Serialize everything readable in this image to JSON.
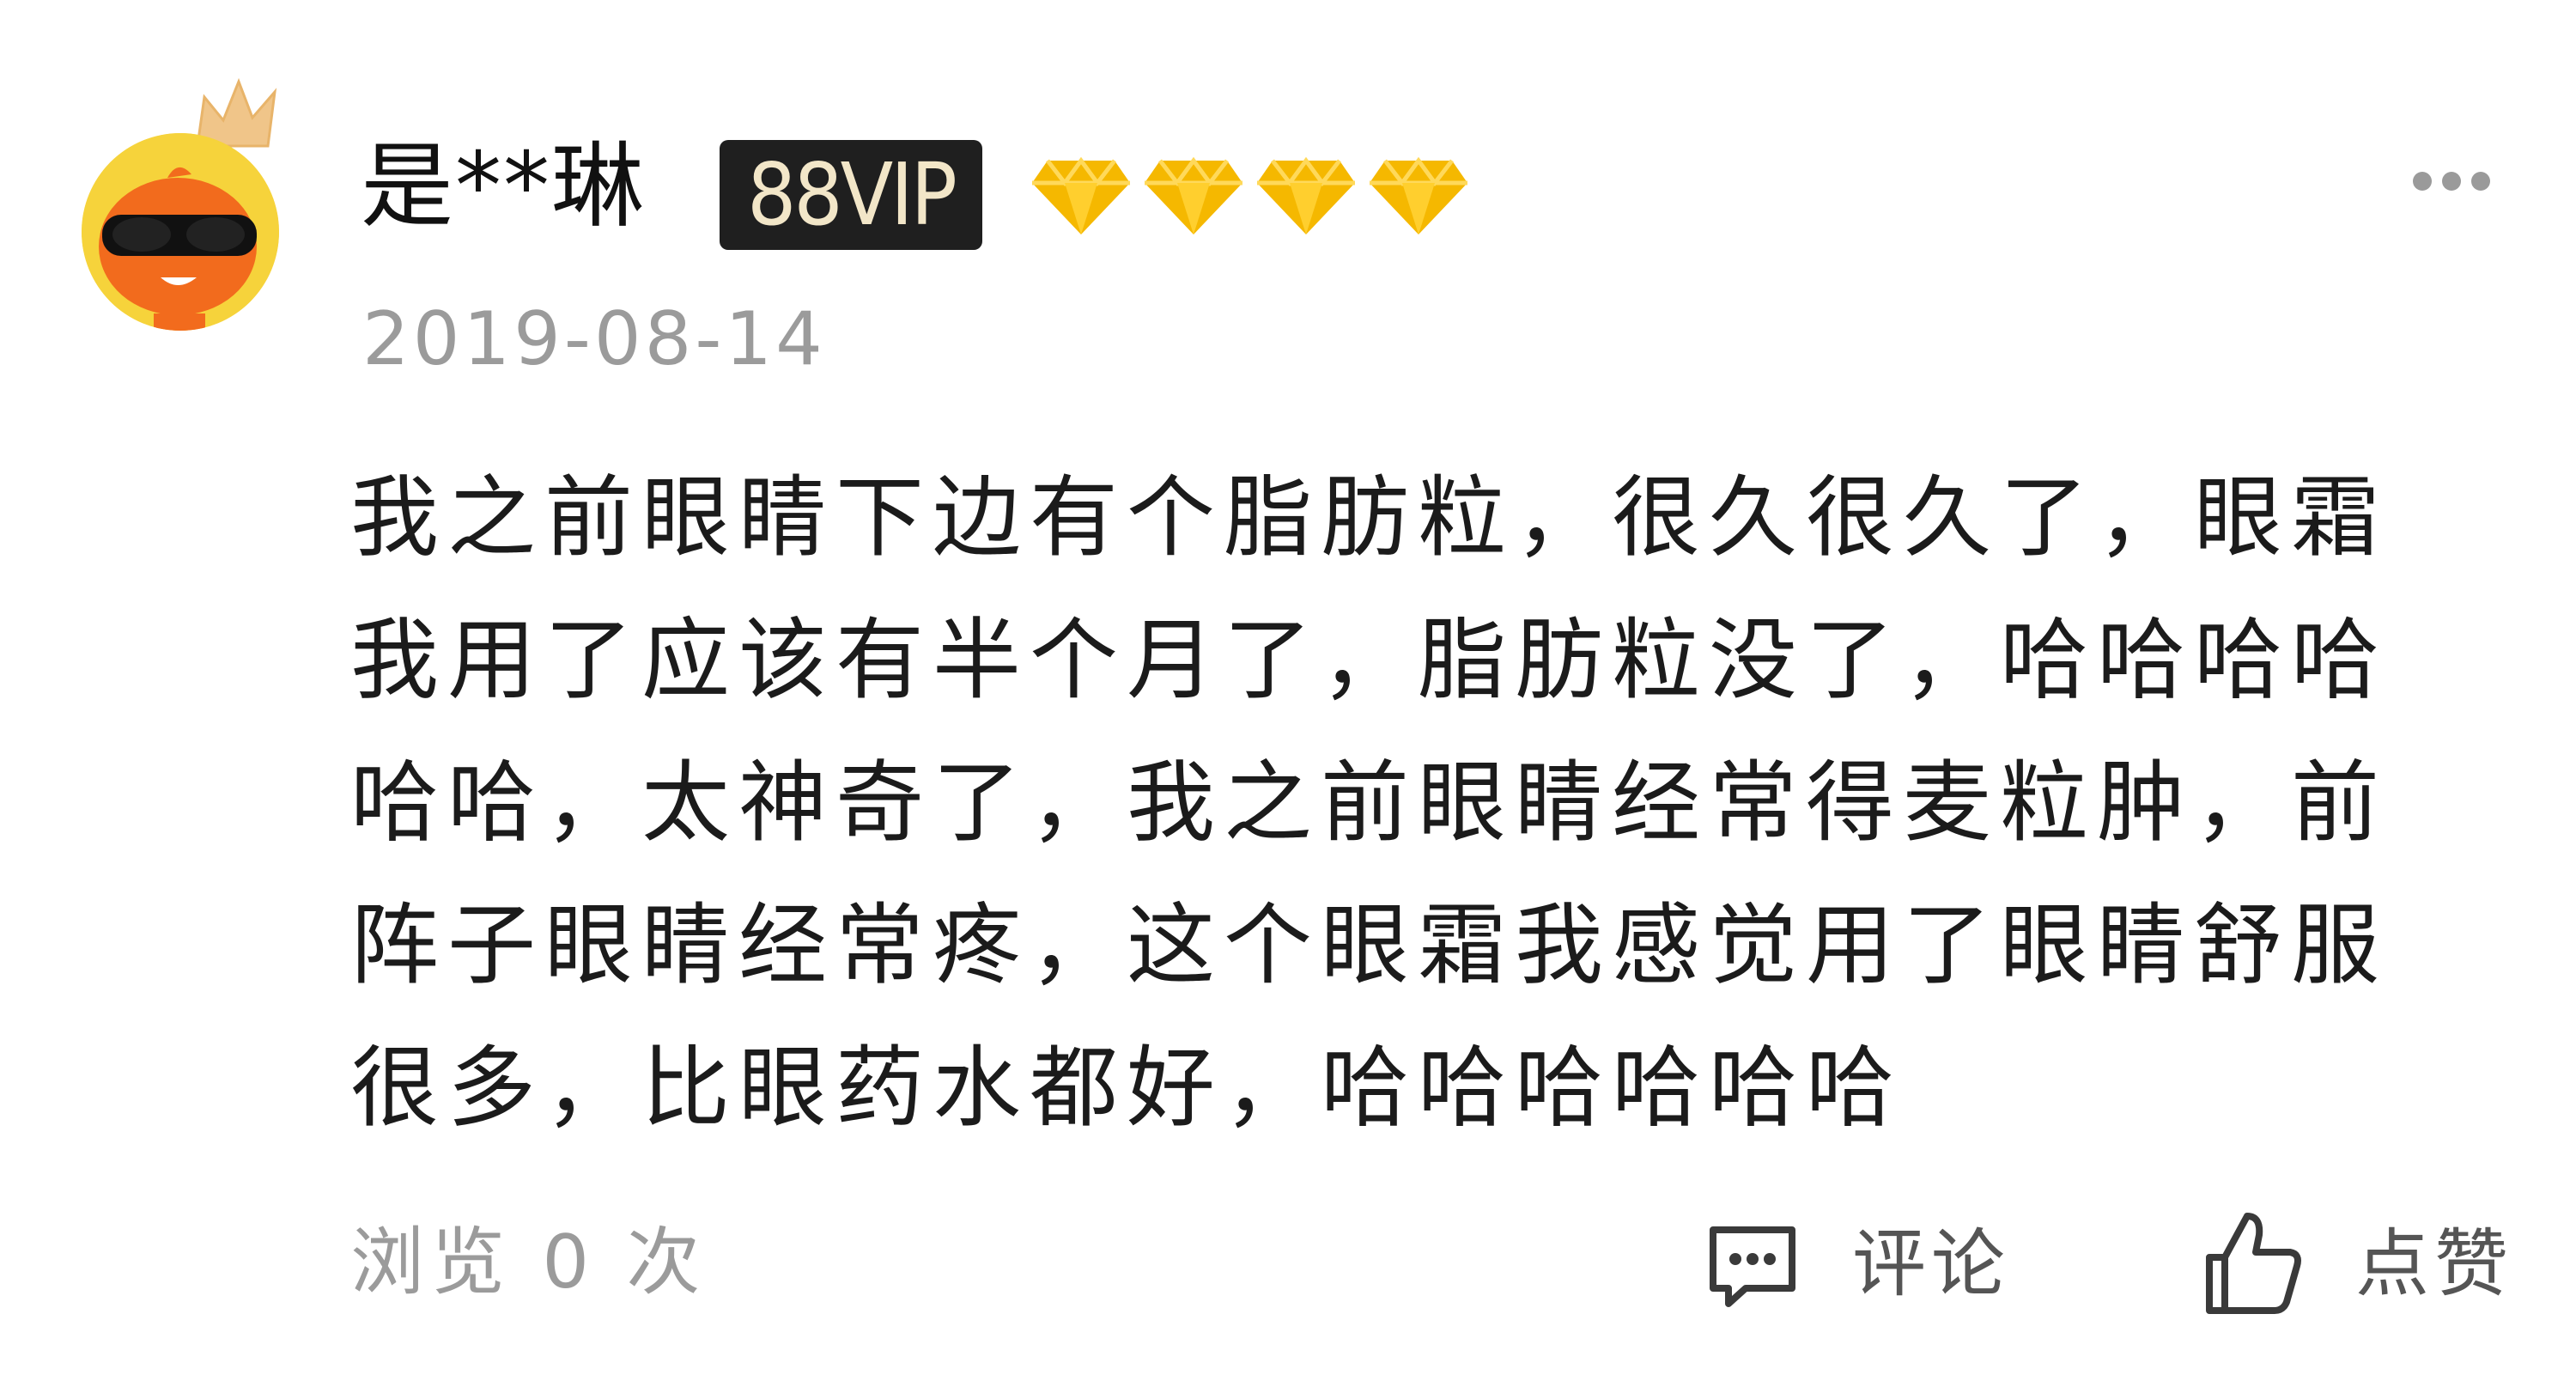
{
  "user": {
    "name": "是**琳",
    "badge": "88VIP",
    "diamond_level": 4,
    "avatar_icon": "sunglasses-mascot-avatar",
    "crown_icon": "crown-icon"
  },
  "review": {
    "date": "2019-08-14",
    "text": "我之前眼睛下边有个脂肪粒，很久很久了，眼霜我用了应该有半个月了，脂肪粒没了，哈哈哈哈哈哈，太神奇了，我之前眼睛经常得麦粒肿，前阵子眼睛经常疼，这个眼霜我感觉用了眼睛舒服很多，比眼药水都好，哈哈哈哈哈哈"
  },
  "footer": {
    "views": "浏览 0 次",
    "comment_label": "评论",
    "like_label": "点赞"
  },
  "colors": {
    "badge_bg": "#1f1f1f",
    "diamond": "#f5b800",
    "muted_text": "#9b9b9b",
    "avatar_bg": "#f6d33b"
  }
}
